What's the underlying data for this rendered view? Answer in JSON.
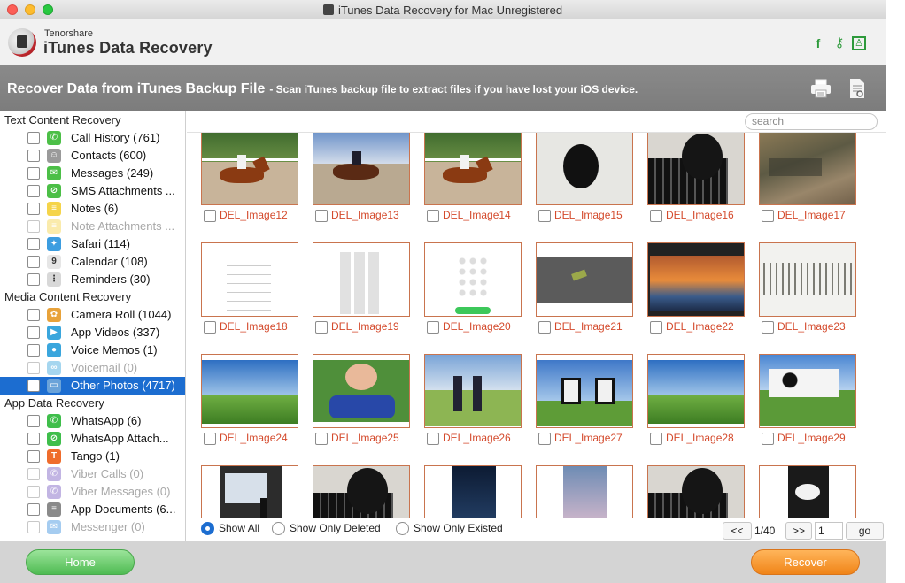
{
  "window": {
    "title": "iTunes Data Recovery for Mac Unregistered"
  },
  "brand": {
    "company": "Tenorshare",
    "product": "iTunes Data Recovery"
  },
  "header_icons": [
    "facebook-icon",
    "key-icon",
    "shop-icon"
  ],
  "banner": {
    "title": "Recover Data from iTunes Backup File",
    "description": "- Scan iTunes backup file to extract files if you have lost your iOS device."
  },
  "sidebar": {
    "sections": [
      {
        "title": "Text Content Recovery",
        "items": [
          {
            "label": "Call History (761)",
            "icon": "phone-icon",
            "color": "#4cbf47",
            "enabled": true
          },
          {
            "label": "Contacts (600)",
            "icon": "contacts-icon",
            "color": "#9a9a9a",
            "enabled": true
          },
          {
            "label": "Messages (249)",
            "icon": "messages-icon",
            "color": "#4cbf47",
            "enabled": true
          },
          {
            "label": "SMS Attachments ...",
            "icon": "attachment-icon",
            "color": "#4cbf47",
            "enabled": true
          },
          {
            "label": "Notes (6)",
            "icon": "notes-icon",
            "color": "#f5d44a",
            "enabled": true
          },
          {
            "label": "Note Attachments ...",
            "icon": "note-attachment-icon",
            "color": "#f5d44a",
            "enabled": false
          },
          {
            "label": "Safari (114)",
            "icon": "safari-icon",
            "color": "#3c9de0",
            "enabled": true
          },
          {
            "label": "Calendar (108)",
            "icon": "calendar-icon",
            "color": "#e6e6e6",
            "enabled": true
          },
          {
            "label": "Reminders (30)",
            "icon": "reminders-icon",
            "color": "#d8d8d8",
            "enabled": true
          }
        ]
      },
      {
        "title": "Media Content Recovery",
        "items": [
          {
            "label": "Camera Roll (1044)",
            "icon": "camera-roll-icon",
            "color": "#e8a23a",
            "enabled": true
          },
          {
            "label": "App Videos (337)",
            "icon": "video-icon",
            "color": "#3aa6dd",
            "enabled": true
          },
          {
            "label": "Voice Memos (1)",
            "icon": "microphone-icon",
            "color": "#3aa6dd",
            "enabled": true
          },
          {
            "label": "Voicemail (0)",
            "icon": "voicemail-icon",
            "color": "#3aa6dd",
            "enabled": false
          },
          {
            "label": "Other Photos (4717)",
            "icon": "photos-icon",
            "color": "#6aa3d9",
            "enabled": true,
            "selected": true
          }
        ]
      },
      {
        "title": "App Data Recovery",
        "items": [
          {
            "label": "WhatsApp (6)",
            "icon": "whatsapp-icon",
            "color": "#3fbe4b",
            "enabled": true
          },
          {
            "label": "WhatsApp Attach...",
            "icon": "whatsapp-attachment-icon",
            "color": "#3fbe4b",
            "enabled": true
          },
          {
            "label": "Tango (1)",
            "icon": "tango-icon",
            "color": "#ef6c2c",
            "enabled": true
          },
          {
            "label": "Viber Calls (0)",
            "icon": "viber-icon",
            "color": "#7a5cc2",
            "enabled": false
          },
          {
            "label": "Viber Messages (0)",
            "icon": "viber-icon",
            "color": "#7a5cc2",
            "enabled": false
          },
          {
            "label": "App Documents (6...",
            "icon": "document-icon",
            "color": "#8a8a8a",
            "enabled": true
          },
          {
            "label": "Messenger (0)",
            "icon": "messenger-icon",
            "color": "#3a8fe0",
            "enabled": false
          }
        ]
      }
    ]
  },
  "search": {
    "placeholder": "search"
  },
  "images": [
    {
      "name": "DEL_Image12",
      "scene": "horse"
    },
    {
      "name": "DEL_Image13",
      "scene": "horse2"
    },
    {
      "name": "DEL_Image14",
      "scene": "horse"
    },
    {
      "name": "DEL_Image15",
      "scene": "mouse"
    },
    {
      "name": "DEL_Image16",
      "scene": "keyboard"
    },
    {
      "name": "DEL_Image17",
      "scene": "aerial"
    },
    {
      "name": "DEL_Image18",
      "scene": "contacts"
    },
    {
      "name": "DEL_Image19",
      "scene": "keypad"
    },
    {
      "name": "DEL_Image20",
      "scene": "dialer"
    },
    {
      "name": "DEL_Image21",
      "scene": "gray"
    },
    {
      "name": "DEL_Image22",
      "scene": "desktop"
    },
    {
      "name": "DEL_Image23",
      "scene": "stripes"
    },
    {
      "name": "DEL_Image24",
      "scene": "field"
    },
    {
      "name": "DEL_Image25",
      "scene": "kids"
    },
    {
      "name": "DEL_Image26",
      "scene": "people"
    },
    {
      "name": "DEL_Image27",
      "scene": "cows"
    },
    {
      "name": "DEL_Image28",
      "scene": "field"
    },
    {
      "name": "DEL_Image29",
      "scene": "cow"
    },
    {
      "name": "",
      "scene": "presentation"
    },
    {
      "name": "",
      "scene": "keyboard"
    },
    {
      "name": "",
      "scene": "night"
    },
    {
      "name": "",
      "scene": "blur"
    },
    {
      "name": "",
      "scene": "keyboard"
    },
    {
      "name": "",
      "scene": "darkphone"
    }
  ],
  "filters": {
    "options": [
      "Show All",
      "Show Only Deleted",
      "Show Only Existed"
    ],
    "selected": "Show All"
  },
  "pager": {
    "prev": "<<",
    "info": "1/40",
    "next": ">>",
    "page": "1",
    "go": "go"
  },
  "footer": {
    "home": "Home",
    "recover": "Recover"
  }
}
